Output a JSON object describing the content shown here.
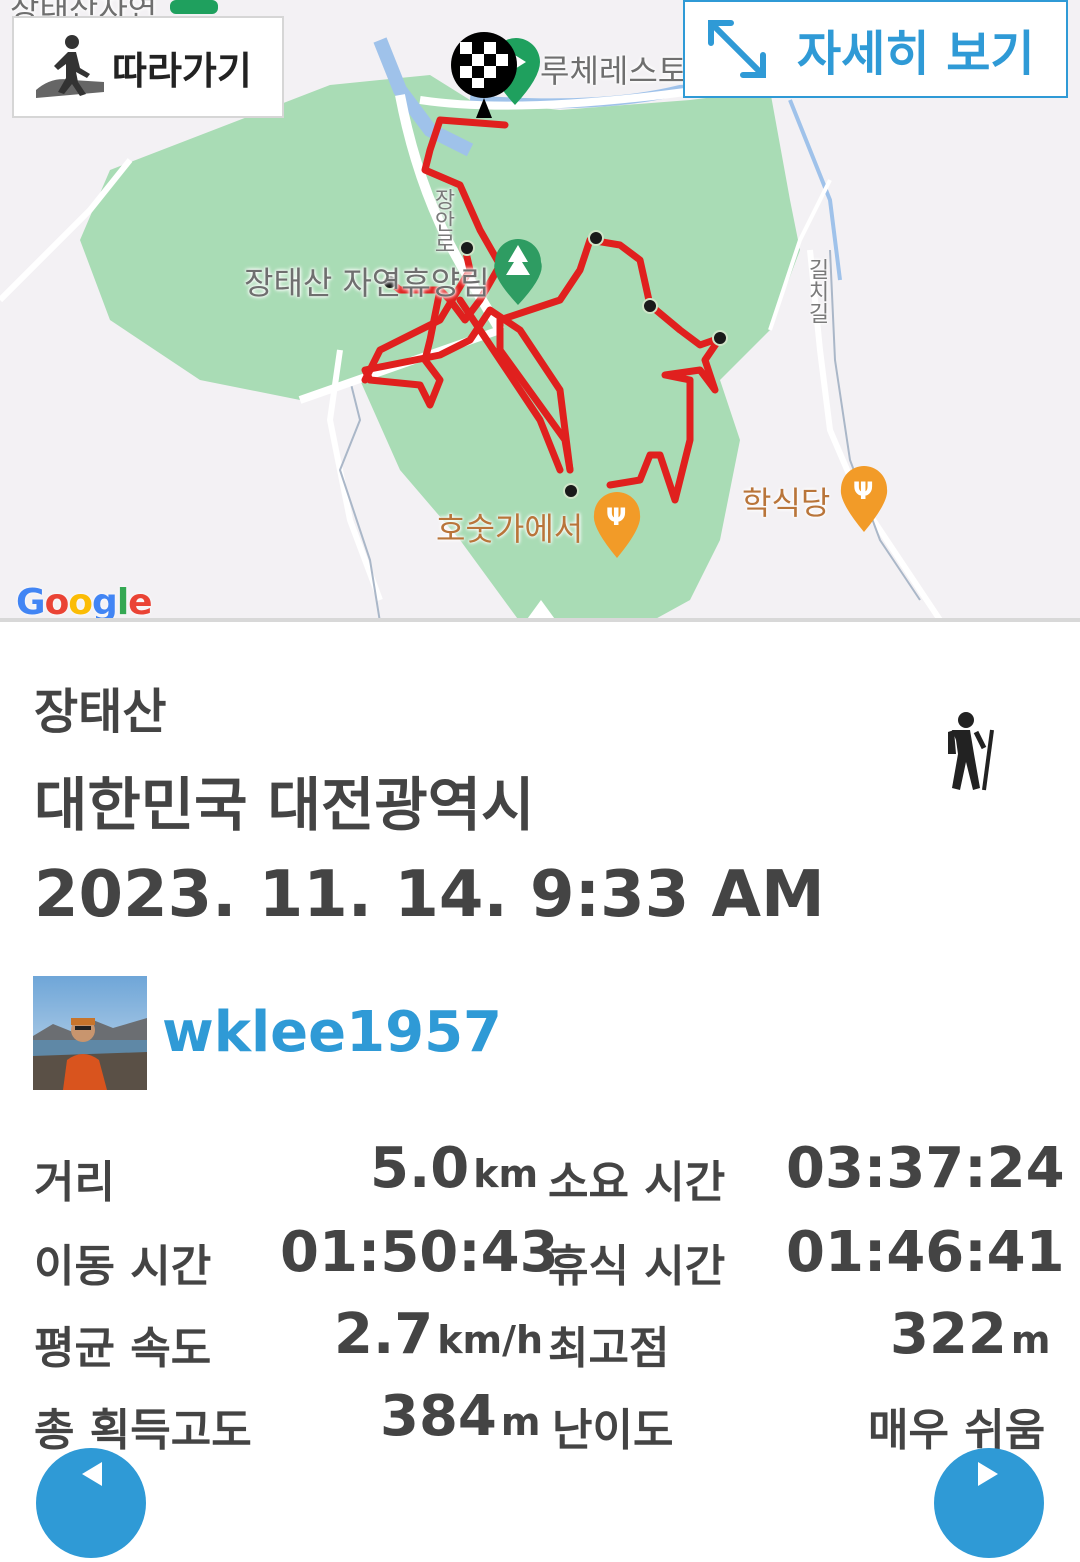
{
  "map": {
    "follow_label": "따라가기",
    "detail_label": "자세히 보기",
    "labels": {
      "top_campground": "장태산자연",
      "restaurant_top": "루체레스토",
      "forest": "장태산 자연휴양림",
      "road_left": "장안로",
      "road_right": "길치길",
      "restaurant_left": "호숫가에서",
      "restaurant_right": "학식당"
    },
    "google_logo": "Google",
    "route_color": "#e0201e",
    "park_color": "#a9dcb5"
  },
  "trail": {
    "name": "장태산",
    "region": "대한민국 대전광역시",
    "datetime": "2023. 11. 14. 9:33 AM",
    "activity_icon": "hiking-icon"
  },
  "user": {
    "username": "wklee1957"
  },
  "stats": {
    "distance": {
      "label": "거리",
      "value": "5.0",
      "unit": "km"
    },
    "total_time": {
      "label": "소요 시간",
      "value": "03:37:24"
    },
    "moving_time": {
      "label": "이동 시간",
      "value": "01:50:43"
    },
    "rest_time": {
      "label": "휴식 시간",
      "value": "01:46:41"
    },
    "avg_speed": {
      "label": "평균 속도",
      "value": "2.7",
      "unit": "km/h"
    },
    "max_elevation": {
      "label": "최고점",
      "value": "322",
      "unit": "m"
    },
    "total_ascent": {
      "label": "총 획득고도",
      "value": "384",
      "unit": "m"
    },
    "difficulty": {
      "label": "난이도",
      "value": "매우 쉬움"
    }
  }
}
